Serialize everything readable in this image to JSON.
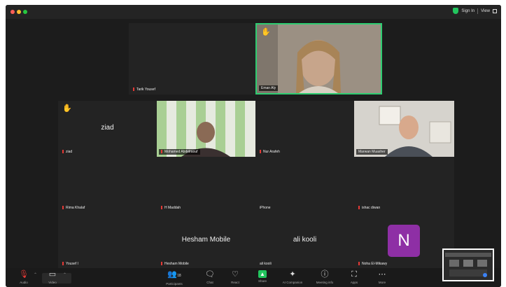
{
  "titlebar": {
    "signin": "Sign In",
    "view": "View"
  },
  "tiles": {
    "tarik": {
      "name": "Tarik Yousef"
    },
    "eman": {
      "name": "Eman Aly"
    },
    "ziad": {
      "display": "ziad",
      "name": "ziad"
    },
    "mohamed": {
      "name": "Mohamed Abdelraouf"
    },
    "nur": {
      "name": "Nur Arafeh"
    },
    "marwan": {
      "name": "Marwan Muasher"
    },
    "rima": {
      "name": "Rima Khalaf"
    },
    "hmaddah": {
      "name": "H Maddah"
    },
    "iphone": {
      "name": "iPhone"
    },
    "ishac": {
      "name": "ishac diwan"
    },
    "yousef": {
      "name": "Yousef I"
    },
    "hesham": {
      "display": "Hesham Mobile",
      "name": "Hesham Mobile"
    },
    "ali": {
      "display": "ali kooli",
      "name": "ali kooli"
    },
    "noha": {
      "initial": "N",
      "name": "Noha El-Mikawy"
    }
  },
  "toolbar": {
    "audio": "Audio",
    "video": "Video",
    "participants": "Participants",
    "participants_count": "18",
    "chat": "Chat",
    "react": "React",
    "share": "Share",
    "ai": "AI Companion",
    "info": "Meeting info",
    "apps": "Apps",
    "more": "More"
  }
}
